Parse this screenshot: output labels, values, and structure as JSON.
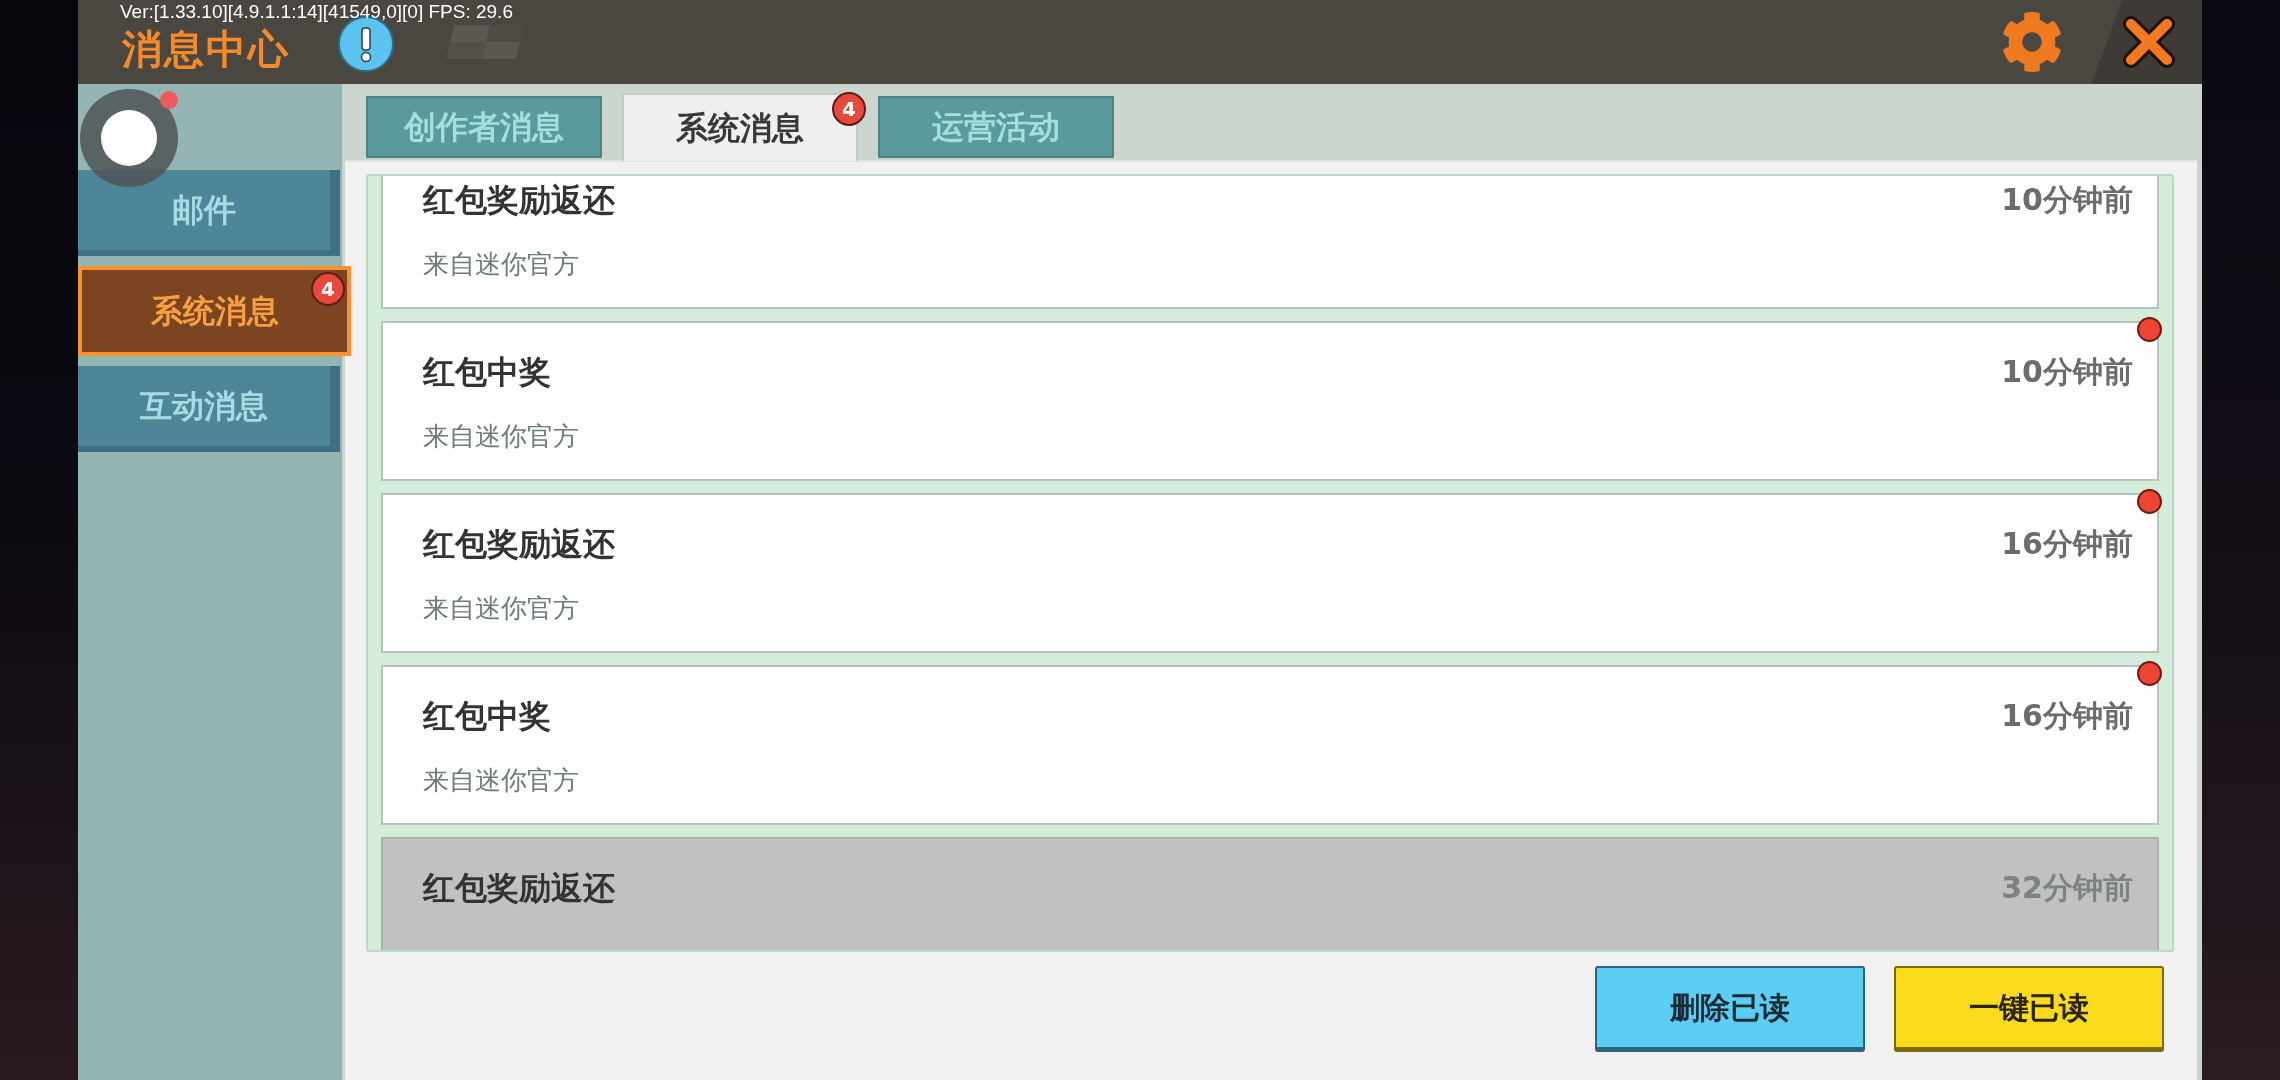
{
  "overlay": {
    "version_text": "Ver:[1.33.10][4.9.1.1:14][41549,0][0] FPS: 29.6",
    "floating_ball": {
      "unread": true
    }
  },
  "window": {
    "title": "消息中心"
  },
  "sidebar": {
    "items": [
      {
        "label": "邮件",
        "selected": false
      },
      {
        "label": "系统消息",
        "selected": true,
        "badge": "4"
      },
      {
        "label": "互动消息",
        "selected": false
      }
    ]
  },
  "tabs": [
    {
      "label": "创作者消息",
      "selected": false
    },
    {
      "label": "系统消息",
      "selected": true,
      "badge": "4"
    },
    {
      "label": "运营活动",
      "selected": false
    }
  ],
  "messages": [
    {
      "title": "红包奖励返还",
      "sender": "来自迷你官方",
      "time": "10分钟前",
      "unread": false,
      "selected": false
    },
    {
      "title": "红包中奖",
      "sender": "来自迷你官方",
      "time": "10分钟前",
      "unread": true,
      "selected": false
    },
    {
      "title": "红包奖励返还",
      "sender": "来自迷你官方",
      "time": "16分钟前",
      "unread": true,
      "selected": false
    },
    {
      "title": "红包中奖",
      "sender": "来自迷你官方",
      "time": "16分钟前",
      "unread": true,
      "selected": false
    },
    {
      "title": "红包奖励返还",
      "time": "32分钟前",
      "unread": false,
      "selected": true
    }
  ],
  "buttons": [
    {
      "label": "删除已读",
      "kind": "secondary"
    },
    {
      "label": "一键已读",
      "kind": "primary"
    }
  ]
}
